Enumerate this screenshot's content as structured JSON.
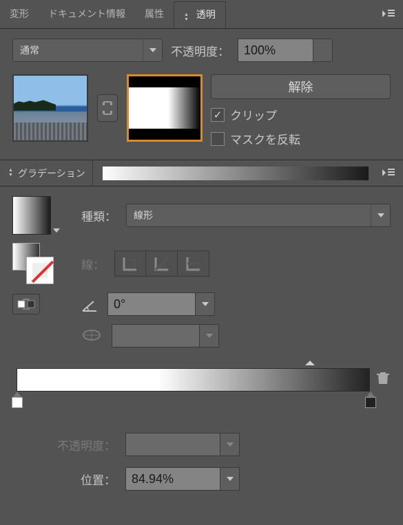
{
  "tabs": {
    "transform": "変形",
    "doc_info": "ドキュメント情報",
    "attributes": "属性",
    "transparency": "透明"
  },
  "transparency": {
    "blend_mode": "通常",
    "opacity_label": "不透明度：",
    "opacity_value": "100%",
    "release_btn": "解除",
    "clip": {
      "checked": true,
      "label": "クリップ"
    },
    "invert": {
      "checked": false,
      "label": "マスクを反転"
    }
  },
  "gradient": {
    "panel_title": "グラデーション",
    "type_label": "種類：",
    "type_value": "線形",
    "stroke_label": "線：",
    "angle_value": "0°",
    "opacity_label": "不透明度：",
    "opacity_value": "",
    "position_label": "位置：",
    "position_value": "84.94%"
  },
  "chart_data": {
    "type": "gradient",
    "stops": [
      {
        "position": 0,
        "color": "#ffffff"
      },
      {
        "position": 100,
        "color": "#222222"
      }
    ],
    "midpoint": 84.94
  }
}
